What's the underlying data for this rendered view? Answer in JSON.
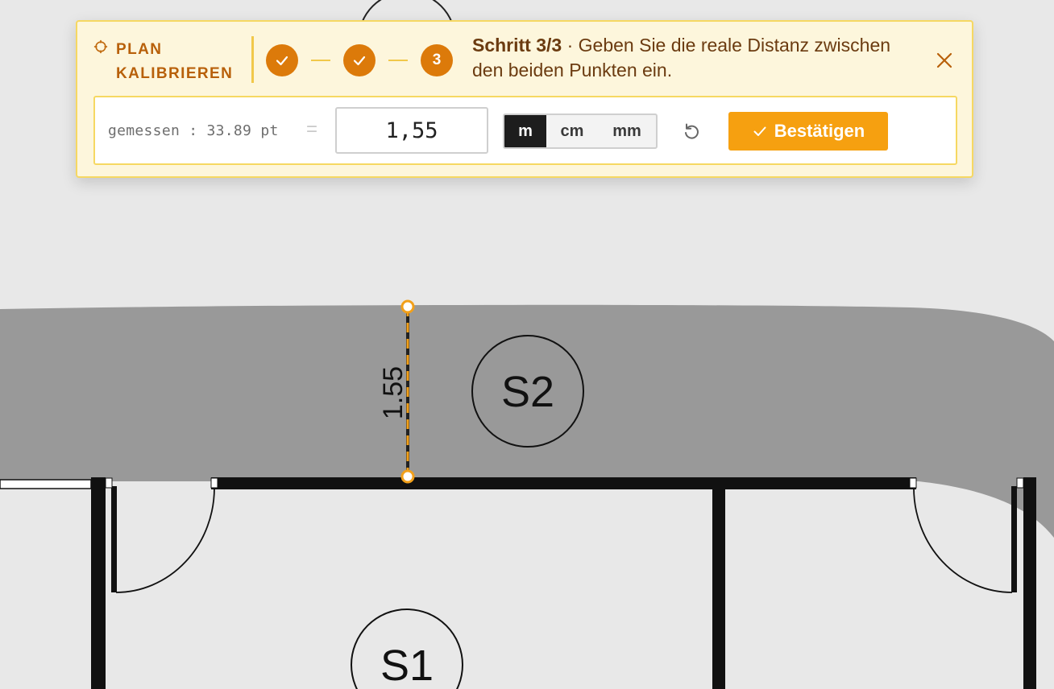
{
  "panel": {
    "title": "PLAN KALIBRIEREN",
    "steps": [
      {
        "state": "done",
        "label": ""
      },
      {
        "state": "done",
        "label": ""
      },
      {
        "state": "active",
        "label": "3"
      }
    ],
    "instruction_step": "Schritt 3/3",
    "instruction_text": " · Geben Sie die reale Distanz zwischen den beiden Punkten ein.",
    "measured_text": "gemessen : 33.89 pt",
    "equals": "=",
    "distance_value": "1,55",
    "units": [
      "m",
      "cm",
      "mm"
    ],
    "selected_unit": "m",
    "confirm_label": "Bestätigen"
  },
  "plan": {
    "measure_label": "1.55",
    "rooms": [
      "S2",
      "S1"
    ]
  },
  "colors": {
    "accent": "#f6a010",
    "step": "#dc7a0a",
    "panel_bg": "#fdf6dc",
    "panel_border": "#f6d862",
    "corridor": "#999999"
  },
  "icons": [
    "target-icon",
    "check-icon",
    "close-icon",
    "reset-icon"
  ]
}
